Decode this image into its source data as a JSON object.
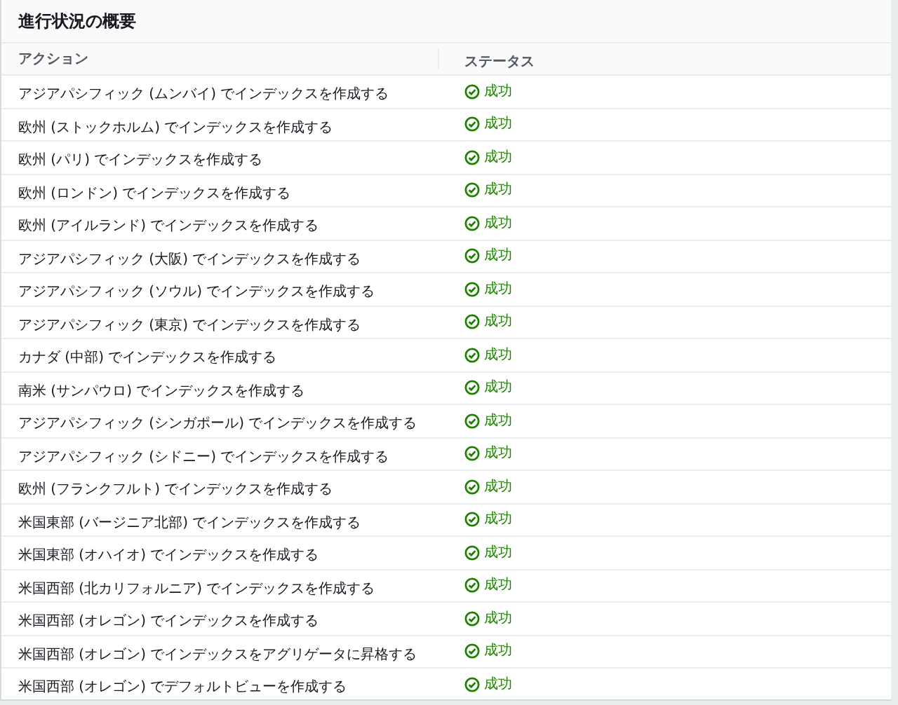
{
  "panel": {
    "title": "進行状況の概要"
  },
  "table": {
    "columns": [
      "アクション",
      "ステータス"
    ],
    "rows": [
      {
        "action": "アジアパシフィック (ムンバイ) でインデックスを作成する",
        "status": {
          "kind": "success",
          "label": "成功"
        }
      },
      {
        "action": "欧州 (ストックホルム) でインデックスを作成する",
        "status": {
          "kind": "success",
          "label": "成功"
        }
      },
      {
        "action": "欧州 (パリ) でインデックスを作成する",
        "status": {
          "kind": "success",
          "label": "成功"
        }
      },
      {
        "action": "欧州 (ロンドン) でインデックスを作成する",
        "status": {
          "kind": "success",
          "label": "成功"
        }
      },
      {
        "action": "欧州 (アイルランド) でインデックスを作成する",
        "status": {
          "kind": "success",
          "label": "成功"
        }
      },
      {
        "action": "アジアパシフィック (大阪) でインデックスを作成する",
        "status": {
          "kind": "success",
          "label": "成功"
        }
      },
      {
        "action": "アジアパシフィック (ソウル) でインデックスを作成する",
        "status": {
          "kind": "success",
          "label": "成功"
        }
      },
      {
        "action": "アジアパシフィック (東京) でインデックスを作成する",
        "status": {
          "kind": "success",
          "label": "成功"
        }
      },
      {
        "action": "カナダ (中部) でインデックスを作成する",
        "status": {
          "kind": "success",
          "label": "成功"
        }
      },
      {
        "action": "南米 (サンパウロ) でインデックスを作成する",
        "status": {
          "kind": "success",
          "label": "成功"
        }
      },
      {
        "action": "アジアパシフィック (シンガポール) でインデックスを作成する",
        "status": {
          "kind": "success",
          "label": "成功"
        }
      },
      {
        "action": "アジアパシフィック (シドニー) でインデックスを作成する",
        "status": {
          "kind": "success",
          "label": "成功"
        }
      },
      {
        "action": "欧州 (フランクフルト) でインデックスを作成する",
        "status": {
          "kind": "success",
          "label": "成功"
        }
      },
      {
        "action": "米国東部 (バージニア北部) でインデックスを作成する",
        "status": {
          "kind": "success",
          "label": "成功"
        }
      },
      {
        "action": "米国東部 (オハイオ) でインデックスを作成する",
        "status": {
          "kind": "success",
          "label": "成功"
        }
      },
      {
        "action": "米国西部 (北カリフォルニア) でインデックスを作成する",
        "status": {
          "kind": "success",
          "label": "成功"
        }
      },
      {
        "action": "米国西部 (オレゴン) でインデックスを作成する",
        "status": {
          "kind": "success",
          "label": "成功"
        }
      },
      {
        "action": "米国西部 (オレゴン) でインデックスをアグリゲータに昇格する",
        "status": {
          "kind": "success",
          "label": "成功"
        }
      },
      {
        "action": "米国西部 (オレゴン) でデフォルトビューを作成する",
        "status": {
          "kind": "success",
          "label": "成功"
        }
      }
    ]
  }
}
